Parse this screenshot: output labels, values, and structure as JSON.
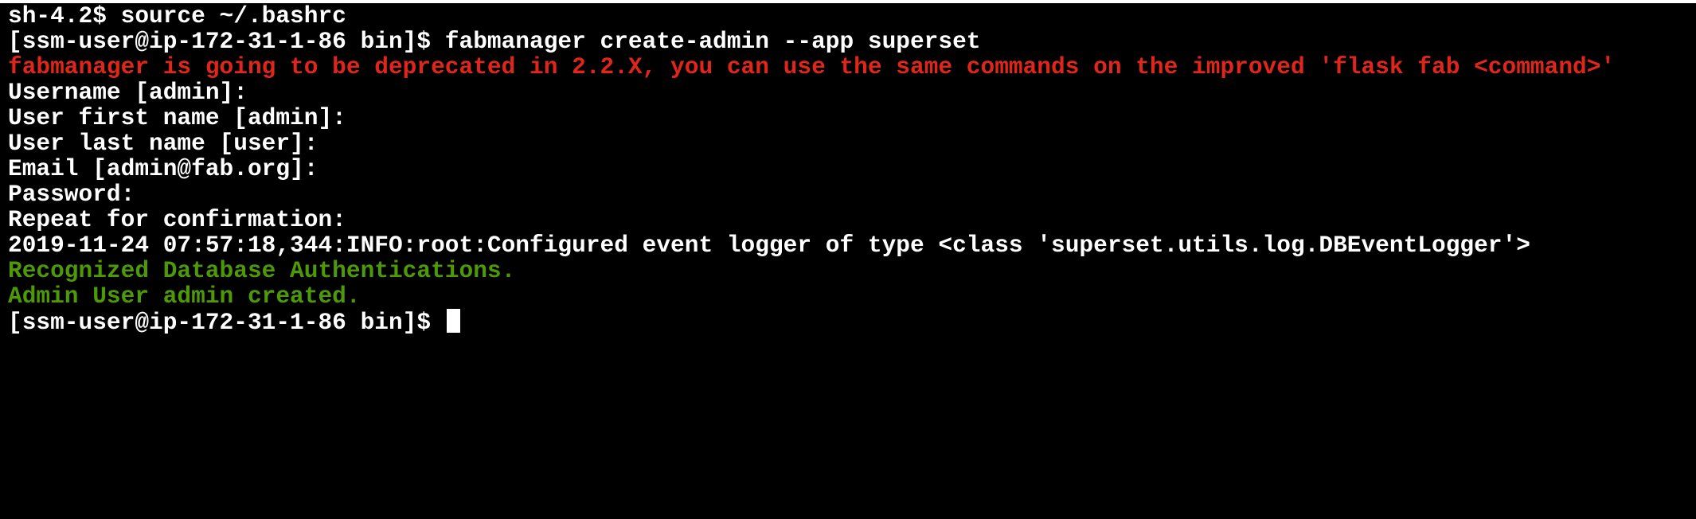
{
  "terminal": {
    "lines": [
      {
        "text": "sh-4.2$ source ~/.bashrc",
        "style": "white"
      },
      {
        "text": "[ssm-user@ip-172-31-1-86 bin]$ fabmanager create-admin --app superset",
        "style": "white"
      },
      {
        "text": "fabmanager is going to be deprecated in 2.2.X, you can use the same commands on the improved 'flask fab <command>'",
        "style": "red"
      },
      {
        "text": "Username [admin]:",
        "style": "white"
      },
      {
        "text": "User first name [admin]:",
        "style": "white"
      },
      {
        "text": "User last name [user]:",
        "style": "white"
      },
      {
        "text": "Email [admin@fab.org]:",
        "style": "white"
      },
      {
        "text": "Password:",
        "style": "white"
      },
      {
        "text": "Repeat for confirmation:",
        "style": "white"
      },
      {
        "text": "2019-11-24 07:57:18,344:INFO:root:Configured event logger of type <class 'superset.utils.log.DBEventLogger'>",
        "style": "white"
      },
      {
        "text": "Recognized Database Authentications.",
        "style": "green"
      },
      {
        "text": "Admin User admin created.",
        "style": "green"
      },
      {
        "text": "[ssm-user@ip-172-31-1-86 bin]$ ",
        "style": "white"
      }
    ]
  },
  "colors": {
    "background": "#000000",
    "text": "#ffffff",
    "warning": "#e0251b",
    "success": "#4e9a06"
  }
}
